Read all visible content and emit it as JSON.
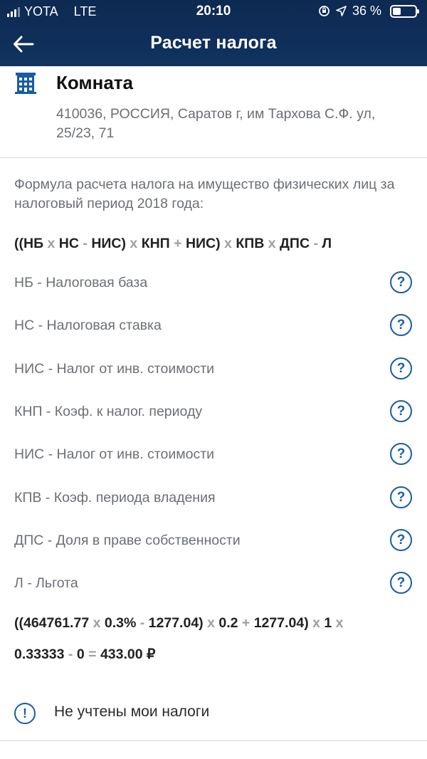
{
  "status_bar": {
    "carrier": "YOTA",
    "network": "LTE",
    "time": "20:10",
    "battery_percent": "36 %",
    "battery_level": 0.36
  },
  "nav": {
    "title": "Расчет налога"
  },
  "property": {
    "title": "Комната",
    "address": "410036, РОССИЯ, Саратов г, им Тархова С.Ф. ул, 25/23, 71",
    "icon": "building-icon"
  },
  "intro_text": "Формула расчета налога на имущество физических лиц за налоговый период 2018 года:",
  "formula": {
    "p1": "((НБ",
    "op1": "x",
    "p2": "НС",
    "op2": "-",
    "p3": "НИС)",
    "op3": "x",
    "p4": "КНП",
    "op4": "+",
    "p5": "НИС)",
    "op5": "x",
    "p6": "КПВ",
    "op6": "x",
    "p7": "ДПС",
    "op7": "-",
    "p8": "Л"
  },
  "definitions": [
    {
      "label": "НБ - Налоговая база"
    },
    {
      "label": "НС - Налоговая ставка"
    },
    {
      "label": "НИС - Налог от инв. стоимости"
    },
    {
      "label": "КНП - Коэф. к налог. периоду"
    },
    {
      "label": "НИС - Налог от инв. стоимости"
    },
    {
      "label": "КПВ - Коэф. периода владения"
    },
    {
      "label": "ДПС - Доля в праве собственности"
    },
    {
      "label": "Л - Льгота"
    }
  ],
  "help_symbol": "?",
  "calculation": {
    "p1": "((464761.77",
    "op1": "x",
    "p2": "0.3%",
    "op2": "-",
    "p3": "1277.04)",
    "op3": "x",
    "p4": "0.2",
    "op4": "+",
    "p5": "1277.04)",
    "op5": "x",
    "p6": "1",
    "op6": "x",
    "p7": "0.33333",
    "op7": "-",
    "p8": "0",
    "op8": "=",
    "result": "433.00 ₽"
  },
  "notice": {
    "symbol": "!",
    "text": "Не учтены мои налоги"
  },
  "colors": {
    "header_bg": "#0f2e5a",
    "accent": "#1a5ca6",
    "secondary_text": "#6b6f75",
    "operator": "#9aa0a6"
  }
}
